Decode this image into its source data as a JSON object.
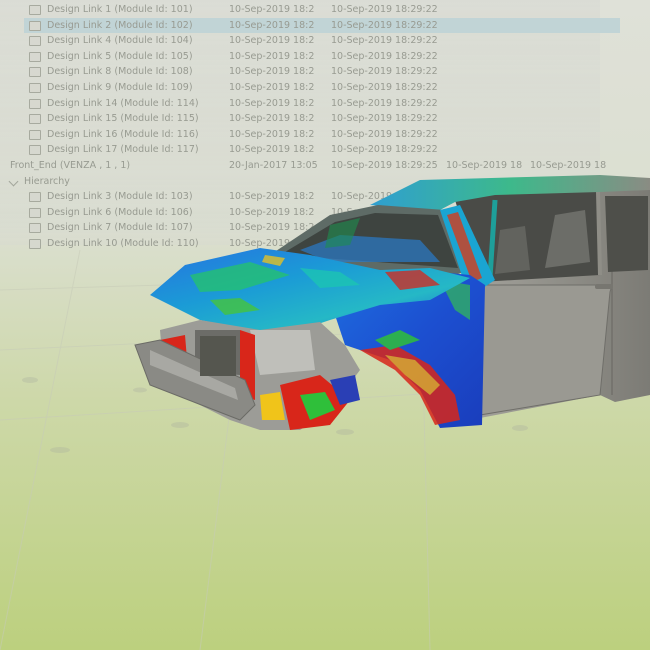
{
  "tree": {
    "rows": [
      {
        "label": "Design Link 1 (Module Id: 101)",
        "created": "10-Sep-2019 18:2",
        "modified": "10-Sep-2019 18:29:22",
        "selected": false
      },
      {
        "label": "Design Link 2 (Module Id: 102)",
        "created": "10-Sep-2019 18:2",
        "modified": "10-Sep-2019 18:29:22",
        "selected": true
      },
      {
        "label": "Design Link 4 (Module Id: 104)",
        "created": "10-Sep-2019 18:2",
        "modified": "10-Sep-2019 18:29:22",
        "selected": false
      },
      {
        "label": "Design Link 5 (Module Id: 105)",
        "created": "10-Sep-2019 18:2",
        "modified": "10-Sep-2019 18:29:22",
        "selected": false
      },
      {
        "label": "Design Link 8 (Module Id: 108)",
        "created": "10-Sep-2019 18:2",
        "modified": "10-Sep-2019 18:29:22",
        "selected": false
      },
      {
        "label": "Design Link 9 (Module Id: 109)",
        "created": "10-Sep-2019 18:2",
        "modified": "10-Sep-2019 18:29:22",
        "selected": false
      },
      {
        "label": "Design Link 14 (Module Id: 114)",
        "created": "10-Sep-2019 18:2",
        "modified": "10-Sep-2019 18:29:22",
        "selected": false
      },
      {
        "label": "Design Link 15 (Module Id: 115)",
        "created": "10-Sep-2019 18:2",
        "modified": "10-Sep-2019 18:29:22",
        "selected": false
      },
      {
        "label": "Design Link 16 (Module Id: 116)",
        "created": "10-Sep-2019 18:2",
        "modified": "10-Sep-2019 18:29:22",
        "selected": false
      },
      {
        "label": "Design Link 17 (Module Id: 117)",
        "created": "10-Sep-2019 18:2",
        "modified": "10-Sep-2019 18:29:22",
        "selected": false
      }
    ],
    "front_end": {
      "label": "Front_End (VENZA , 1 , 1)",
      "created": "20-Jan-2017 13:05",
      "modified": "10-Sep-2019 18:29:25",
      "date3": "10-Sep-2019 18",
      "date4": "10-Sep-2019 18"
    },
    "hierarchy_label": "Hierarchy",
    "hierarchy_rows": [
      {
        "label": "Design Link 3 (Module Id: 103)",
        "created": "10-Sep-2019 18:2",
        "modified": "10-Sep-2019 18:29:22"
      },
      {
        "label": "Design Link 6 (Module Id: 106)",
        "created": "10-Sep-2019 18:2",
        "modified": "10-Sep-2019 18:29:22"
      },
      {
        "label": "Design Link 7 (Module Id: 107)",
        "created": "10-Sep-2019 18:2",
        "modified": "10-Sep-2019 18:29:22"
      },
      {
        "label": "Design Link 10 (Module Id: 110)",
        "created": "10-Sep-2019 18:2",
        "modified": "10-Sep-2019 18:29:22"
      }
    ]
  },
  "colors": {
    "selection": "#bcd2d6",
    "body_gray": "#8d8c86",
    "contour_blue": "#1d5fd8",
    "contour_red": "#d81d12",
    "contour_green": "#2fbf3a"
  }
}
